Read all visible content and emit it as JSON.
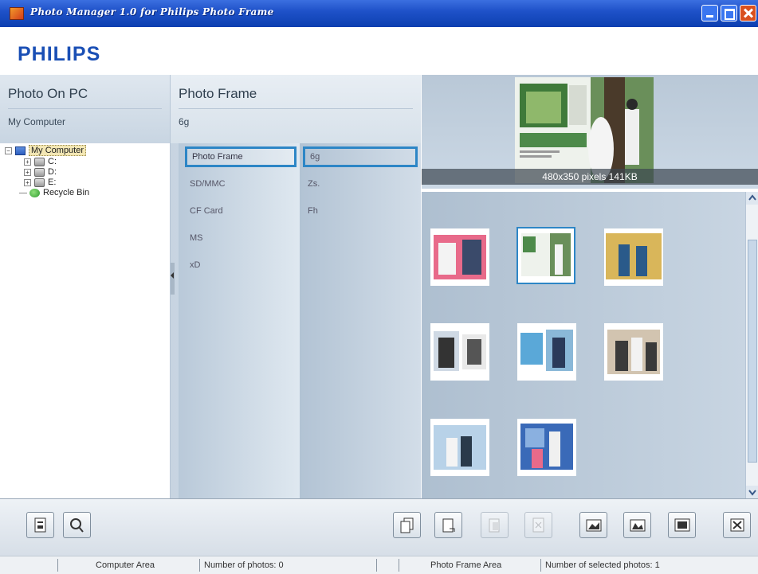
{
  "window": {
    "title": "Photo Manager 1.0 for Philips Photo Frame",
    "brand": "PHILIPS"
  },
  "left_panel": {
    "title": "Photo On PC",
    "subtitle": "My Computer",
    "tree": [
      {
        "label": "My Computer",
        "icon": "computer-icon"
      },
      {
        "label": "C:",
        "icon": "drive-icon"
      },
      {
        "label": "D:",
        "icon": "drive-icon"
      },
      {
        "label": "E:",
        "icon": "drive-icon"
      },
      {
        "label": "Recycle Bin",
        "icon": "recycle-bin-icon"
      }
    ]
  },
  "middle_panel": {
    "title": "Photo Frame",
    "subtitle": "6g",
    "memory_items": [
      "Photo Frame",
      "SD/MMC",
      "CF Card",
      "MS",
      "xD"
    ],
    "capacity_items": [
      "6g",
      "Zs.",
      "Fh"
    ]
  },
  "preview": {
    "caption": "480x350 pixels  141KB"
  },
  "thumbnails": {
    "count": 8,
    "selected_index": 1
  },
  "toolbar": {
    "left_buttons": [
      "properties-icon",
      "search-icon"
    ],
    "right_buttons": [
      "copy-icon",
      "paste-icon",
      "move-icon",
      "delete-icon",
      "rotate-left-icon",
      "rotate-right-icon",
      "slideshow-icon",
      "close-icon"
    ]
  },
  "status": {
    "computer_area": "Computer Area",
    "photos_count": "Number of photos: 0",
    "frame_area": "Photo Frame Area",
    "selected_count": "Number of selected photos: 1"
  },
  "colors": {
    "accent": "#2d86c6",
    "title_bar": "#1f52c9",
    "brand": "#1a4fb5"
  }
}
